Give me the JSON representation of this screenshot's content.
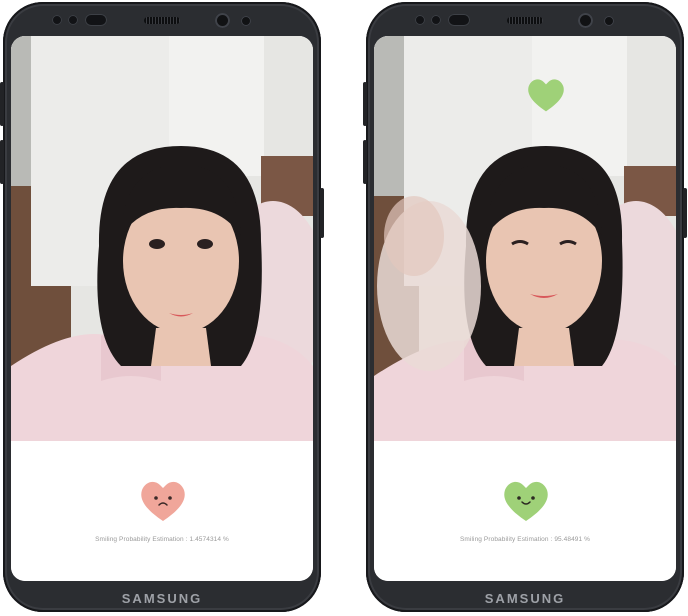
{
  "screens": [
    {
      "mood": "sad",
      "heart_color": "#f0a69a",
      "probability_text": "Smiling Probability Estimation : 1.4574314 %",
      "show_floating_heart": false
    },
    {
      "mood": "happy",
      "heart_color": "#9fd178",
      "probability_text": "Smiling Probability Estimation : 95.48491 %",
      "show_floating_heart": true
    }
  ],
  "device": {
    "brand": "SAMSUNG"
  }
}
